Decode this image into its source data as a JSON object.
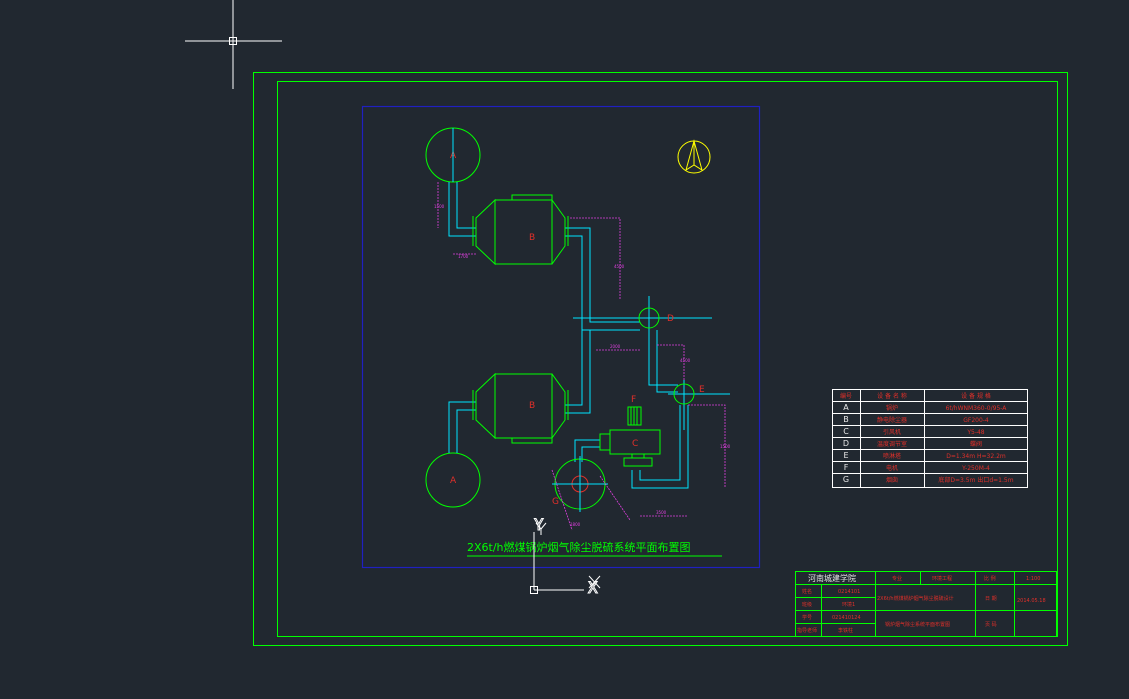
{
  "drawing": {
    "title": "2X6t/h燃煤锅炉烟气除尘脱硫系统平面布置图",
    "equipment_labels": {
      "boiler_top": "A",
      "boiler_bottom": "A",
      "collector_top": "B",
      "collector_bottom": "B",
      "fan": "C",
      "valve": "D",
      "tower": "E",
      "motor": "F",
      "chimney": "G"
    },
    "dimension_labels": [
      "1500",
      "1700",
      "4500",
      "2000",
      "4500",
      "1500",
      "3500",
      "1800"
    ]
  },
  "equipment_table": {
    "headers": [
      "编号",
      "设 备 名 称",
      "设 备 规 格"
    ],
    "rows": [
      [
        "A",
        "锅炉",
        "6t/hWNM360-0/95-A"
      ],
      [
        "B",
        "静电除尘器",
        "GF200-4"
      ],
      [
        "C",
        "引风机",
        "Y5-48"
      ],
      [
        "D",
        "温度调节室",
        "蝶阀"
      ],
      [
        "E",
        "喷淋塔",
        "D=1.34m H=32.2m"
      ],
      [
        "F",
        "电机",
        "Y-250M-4"
      ],
      [
        "G",
        "烟囱",
        "底部D=3.5m 出口d=1.5m"
      ]
    ]
  },
  "title_block": {
    "school": "河南城建学院",
    "major_label": "专业",
    "major_value": "环境工程",
    "scale_label": "比 例",
    "scale_value": "1:100",
    "name_label": "姓名",
    "name_value": "0214101",
    "class_label": "班级",
    "class_value": "环境1",
    "student_no_label": "学号",
    "student_no_value": "021410124",
    "teacher_label": "指导老师",
    "teacher_value": "李铁柱",
    "project": "2X6t/h燃煤锅炉烟气除尘脱硫设计",
    "date_label": "日 期",
    "date_value": "2014.05.18",
    "drawing_name": "锅炉烟气除尘系统平面布置图",
    "sheet_label": "页 码"
  },
  "ucs": {
    "x_label": "X",
    "y_label": "Y"
  },
  "colors": {
    "background": "#212830",
    "frame": "#00ff00",
    "viewport": "#1f1fb0",
    "equipment": "#00ff00",
    "pipe": "#00e5ff",
    "dimension": "#e040e0",
    "label": "#e0302a",
    "compass": "#ffff00"
  }
}
